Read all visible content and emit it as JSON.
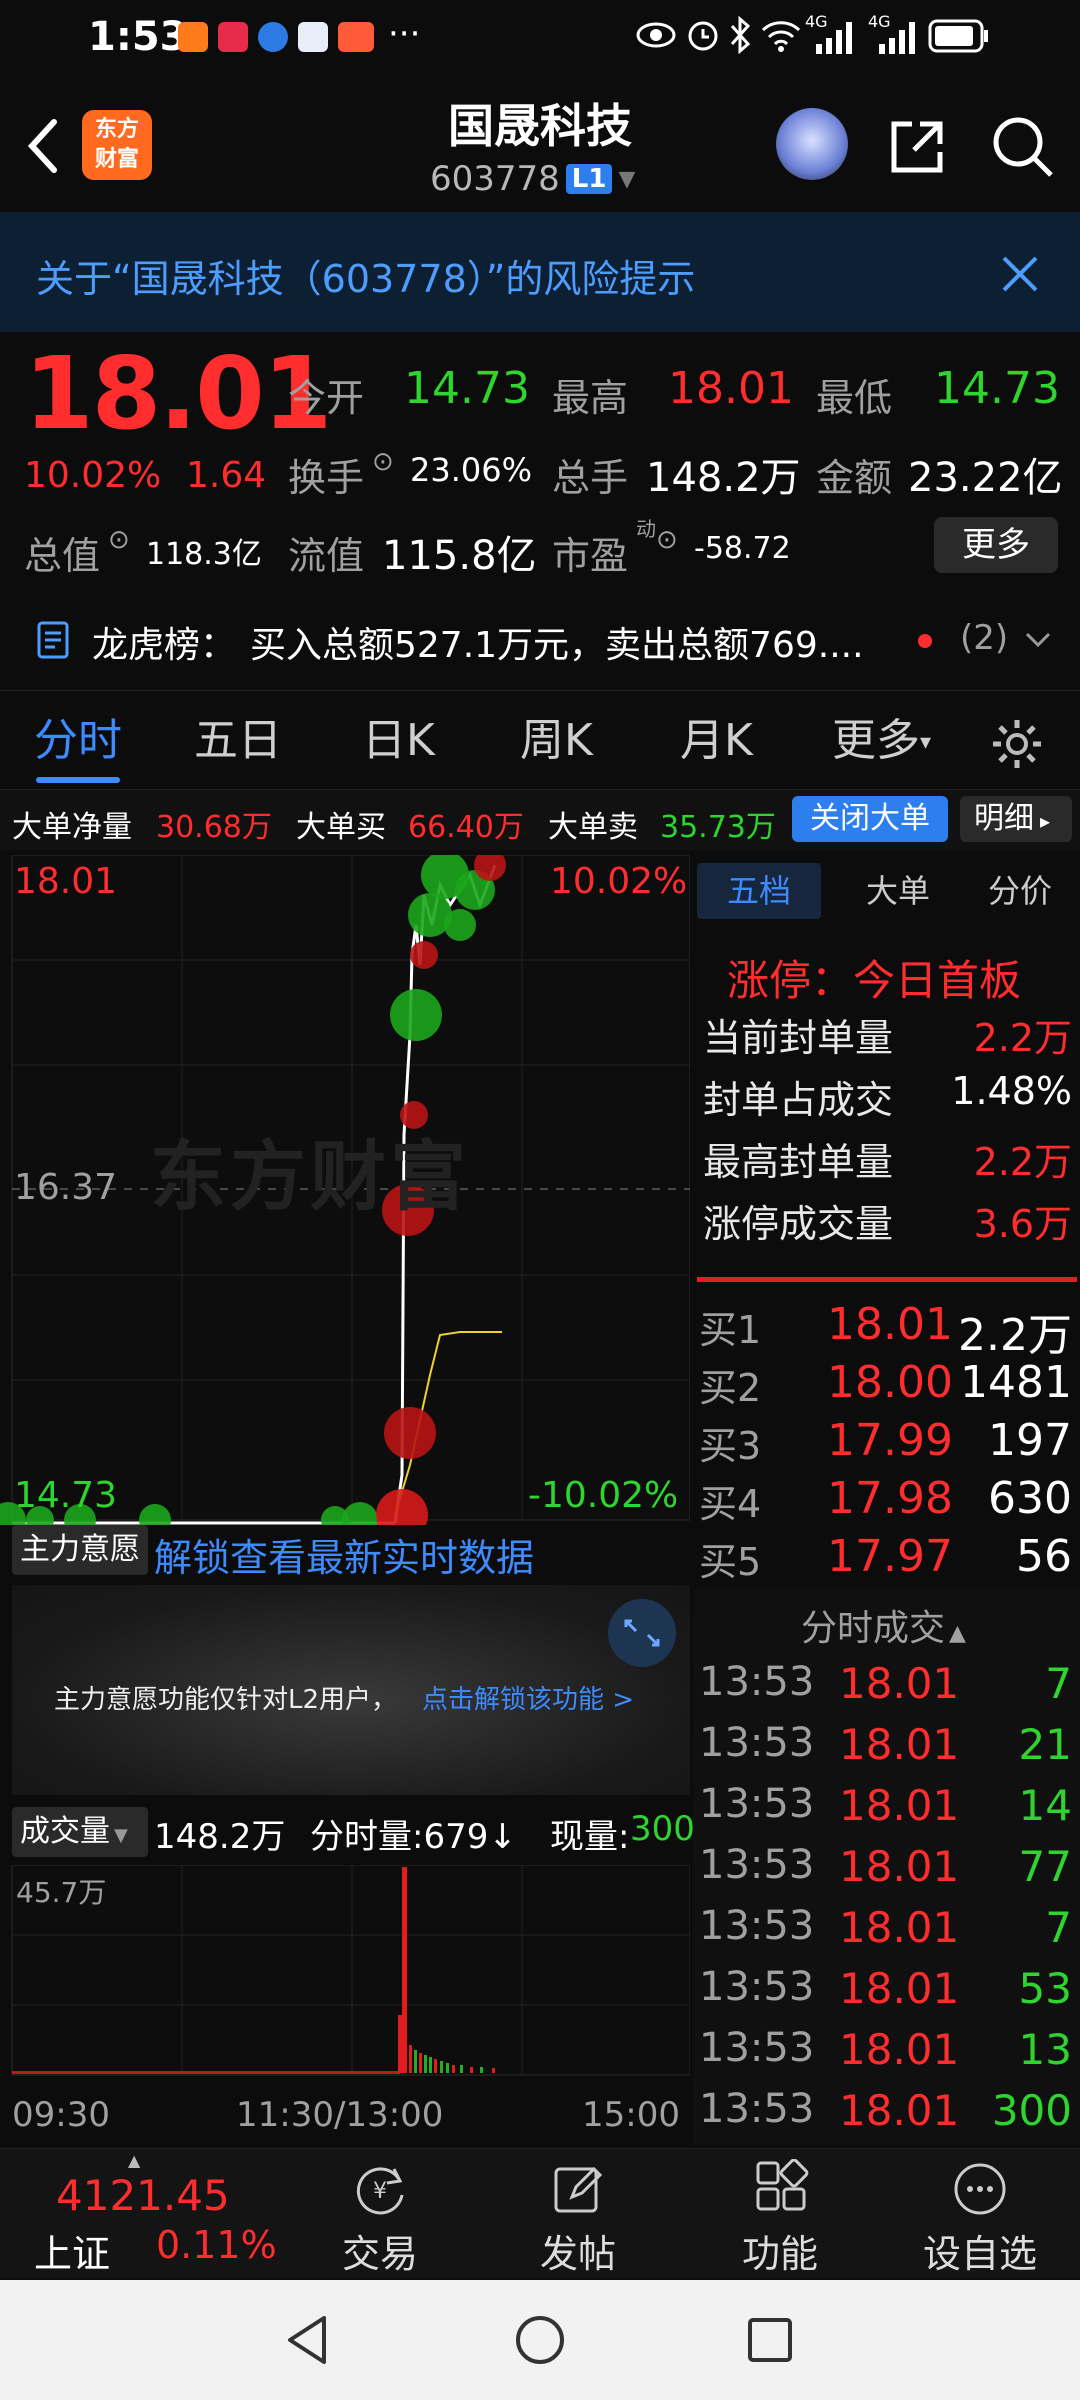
{
  "status": {
    "time": "1:53",
    "signal1": "4G",
    "signal2": "4G"
  },
  "header": {
    "title": "国晟科技",
    "code": "603778",
    "level": "L1",
    "logo_line1": "东方",
    "logo_line2": "财富"
  },
  "risk": {
    "text": "关于“国晟科技（603778）”的风险提示"
  },
  "quote": {
    "price": "18.01",
    "change_pct": "10.02%",
    "change": "1.64",
    "open_label": "今开",
    "open": "14.73",
    "high_label": "最高",
    "high": "18.01",
    "low_label": "最低",
    "low": "14.73",
    "turnover_label": "换手",
    "turnover": "23.06%",
    "volume_label": "总手",
    "volume": "148.2万",
    "amount_label": "金额",
    "amount": "23.22亿",
    "mcap_label": "总值",
    "mcap": "118.3亿",
    "float_label": "流值",
    "float": "115.8亿",
    "pe_label": "市盈",
    "pe_sup": "动",
    "pe": "-58.72",
    "more": "更多"
  },
  "dragon": {
    "label": "龙虎榜：",
    "text": "买入总额527.1万元，卖出总额769....",
    "count": "(2)"
  },
  "tabs": [
    "分时",
    "五日",
    "日K",
    "周K",
    "月K",
    "更多"
  ],
  "bigorder": {
    "net_label": "大单净量",
    "net": "30.68万",
    "buy_label": "大单买",
    "buy": "66.40万",
    "sell_label": "大单卖",
    "sell": "35.73万",
    "close_btn": "关闭大单",
    "detail_btn": "明细"
  },
  "chart": {
    "high_price": "18.01",
    "high_pct": "10.02%",
    "mid_price": "16.37",
    "low_price": "14.73",
    "low_pct": "-10.02%",
    "watermark": "东方财富",
    "intent_label": "主力意愿",
    "unlock_text": "解锁查看最新实时数据",
    "l2_notice": "主力意愿功能仅针对L2用户，",
    "l2_link": "点击解锁该功能 >",
    "vol_label": "成交量",
    "vol_total": "148.2万",
    "vol_period": "分时量:679↓",
    "vol_now_label": "现量:",
    "vol_now": "300",
    "vol_max": "45.7万",
    "t_start": "09:30",
    "t_mid": "11:30/13:00",
    "t_end": "15:00"
  },
  "right": {
    "tabs": [
      "五档",
      "大单",
      "分价"
    ],
    "limit_title": "涨停：今日首板",
    "stats": [
      {
        "label": "当前封单量",
        "value": "2.2万",
        "color": "red"
      },
      {
        "label": "封单占成交",
        "value": "1.48%",
        "color": "white"
      },
      {
        "label": "最高封单量",
        "value": "2.2万",
        "color": "red"
      },
      {
        "label": "涨停成交量",
        "value": "3.6万",
        "color": "red"
      }
    ],
    "bids": [
      {
        "label": "买1",
        "price": "18.01",
        "qty": "2.2万"
      },
      {
        "label": "买2",
        "price": "18.00",
        "qty": "1481"
      },
      {
        "label": "买3",
        "price": "17.99",
        "qty": "197"
      },
      {
        "label": "买4",
        "price": "17.98",
        "qty": "630"
      },
      {
        "label": "买5",
        "price": "17.97",
        "qty": "56"
      }
    ],
    "ticks_title": "分时成交",
    "ticks": [
      {
        "t": "13:53",
        "p": "18.01",
        "q": "7"
      },
      {
        "t": "13:53",
        "p": "18.01",
        "q": "21"
      },
      {
        "t": "13:53",
        "p": "18.01",
        "q": "14"
      },
      {
        "t": "13:53",
        "p": "18.01",
        "q": "77"
      },
      {
        "t": "13:53",
        "p": "18.01",
        "q": "7"
      },
      {
        "t": "13:53",
        "p": "18.01",
        "q": "53"
      },
      {
        "t": "13:53",
        "p": "18.01",
        "q": "13"
      },
      {
        "t": "13:53",
        "p": "18.01",
        "q": "300"
      }
    ]
  },
  "bottom": {
    "index_value": "4121.45",
    "index_name": "上证",
    "index_pct": "0.11%",
    "nav": [
      "交易",
      "发帖",
      "功能",
      "设自选"
    ]
  }
}
